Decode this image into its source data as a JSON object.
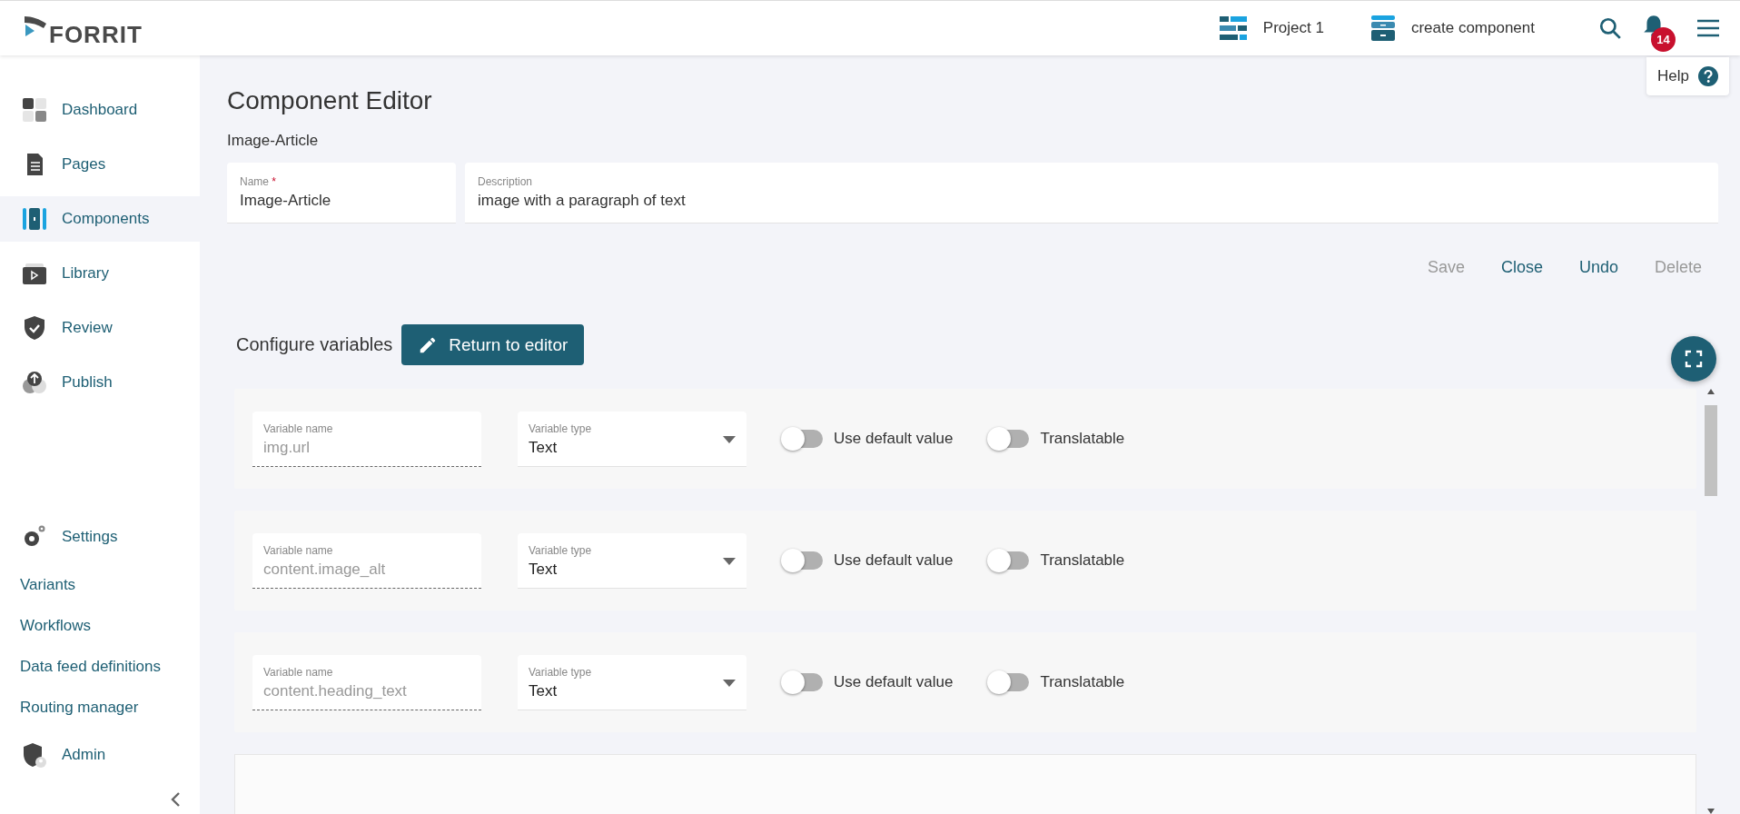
{
  "header": {
    "logo": "FORRIT",
    "project": "Project 1",
    "context": "create component",
    "notifications": "14",
    "help": "Help"
  },
  "sidebar": {
    "items": [
      {
        "label": "Dashboard",
        "selected": false
      },
      {
        "label": "Pages",
        "selected": false
      },
      {
        "label": "Components",
        "selected": true
      },
      {
        "label": "Library",
        "selected": false
      },
      {
        "label": "Review",
        "selected": false
      },
      {
        "label": "Publish",
        "selected": false
      }
    ],
    "settings": {
      "label": "Settings",
      "items": [
        "Variants",
        "Workflows",
        "Data feed definitions",
        "Routing manager"
      ]
    },
    "admin": "Admin"
  },
  "editor": {
    "title": "Component Editor",
    "subtitle": "Image-Article",
    "name_field": {
      "label": "Name",
      "required": true,
      "required_mark": "*",
      "value": "Image-Article"
    },
    "description_field": {
      "label": "Description",
      "value": "image with a paragraph of text"
    },
    "actions": [
      {
        "label": "Save",
        "disabled": true
      },
      {
        "label": "Close",
        "disabled": false
      },
      {
        "label": "Undo",
        "disabled": false
      },
      {
        "label": "Delete",
        "disabled": true
      }
    ],
    "configure_label": "Configure variables",
    "return_button": "Return to editor",
    "variables": [
      {
        "name_label": "Variable name",
        "name": "img.url",
        "disabled": true,
        "type_label": "Variable type",
        "type": "Text",
        "toggles": [
          {
            "label": "Use default value",
            "on": false
          },
          {
            "label": "Translatable",
            "on": false
          }
        ]
      },
      {
        "name_label": "Variable name",
        "name": "content.image_alt",
        "disabled": true,
        "type_label": "Variable type",
        "type": "Text",
        "toggles": [
          {
            "label": "Use default value",
            "on": false
          },
          {
            "label": "Translatable",
            "on": false
          }
        ]
      },
      {
        "name_label": "Variable name",
        "name": "content.heading_text",
        "disabled": true,
        "type_label": "Variable type",
        "type": "Text",
        "toggles": [
          {
            "label": "Use default value",
            "on": false
          },
          {
            "label": "Translatable",
            "on": false
          }
        ]
      }
    ]
  }
}
